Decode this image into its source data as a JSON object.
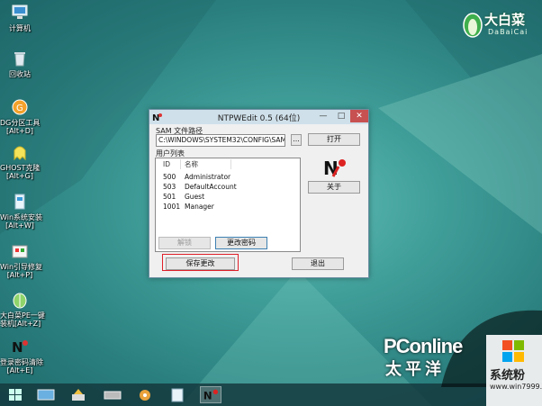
{
  "desktop": {
    "icons": [
      {
        "label": "计算机",
        "icon": "computer-icon"
      },
      {
        "label": "回收站",
        "icon": "recycle-bin-icon"
      },
      {
        "label": "DG分区工具",
        "label2": "[Alt+D]",
        "icon": "partition-tool-icon"
      },
      {
        "label": "GHOST克隆",
        "label2": "[Alt+G]",
        "icon": "ghost-icon"
      },
      {
        "label": "Win系统安装",
        "label2": "[Alt+W]",
        "icon": "win-install-icon"
      },
      {
        "label": "Win引导修复",
        "label2": "[Alt+P]",
        "icon": "boot-repair-icon"
      },
      {
        "label": "大白菜PE一键",
        "label2": "装机[Alt+Z]",
        "icon": "dabaicai-install-icon"
      },
      {
        "label": "登录密码清除",
        "label2": "[Alt+E]",
        "icon": "password-clear-icon"
      }
    ]
  },
  "brand": {
    "name": "大白菜",
    "sub": "DaBaiCai"
  },
  "window": {
    "title": "NTPWEdit 0.5 (64位)",
    "controls": {
      "minimize": "—",
      "maximize": "□",
      "close": "✕"
    },
    "sam_label": "SAM 文件路径",
    "sam_path": "C:\\WINDOWS\\SYSTEM32\\CONFIG\\SAM",
    "browse_label": "...",
    "open_label": "打开",
    "userlist_label": "用户列表",
    "columns": [
      "ID",
      "名称"
    ],
    "users": [
      {
        "id": "500",
        "name": "Administrator"
      },
      {
        "id": "503",
        "name": "DefaultAccount"
      },
      {
        "id": "501",
        "name": "Guest"
      },
      {
        "id": "1001",
        "name": "Manager"
      }
    ],
    "about_label": "关于",
    "unlock_label": "解锁",
    "change_pw_label": "更改密码",
    "save_label": "保存更改",
    "exit_label": "退出"
  },
  "watermark": {
    "pc": "PConline",
    "pc_cn": "太平洋",
    "site_name": "系统粉",
    "site_url": "www.win7999.com"
  }
}
